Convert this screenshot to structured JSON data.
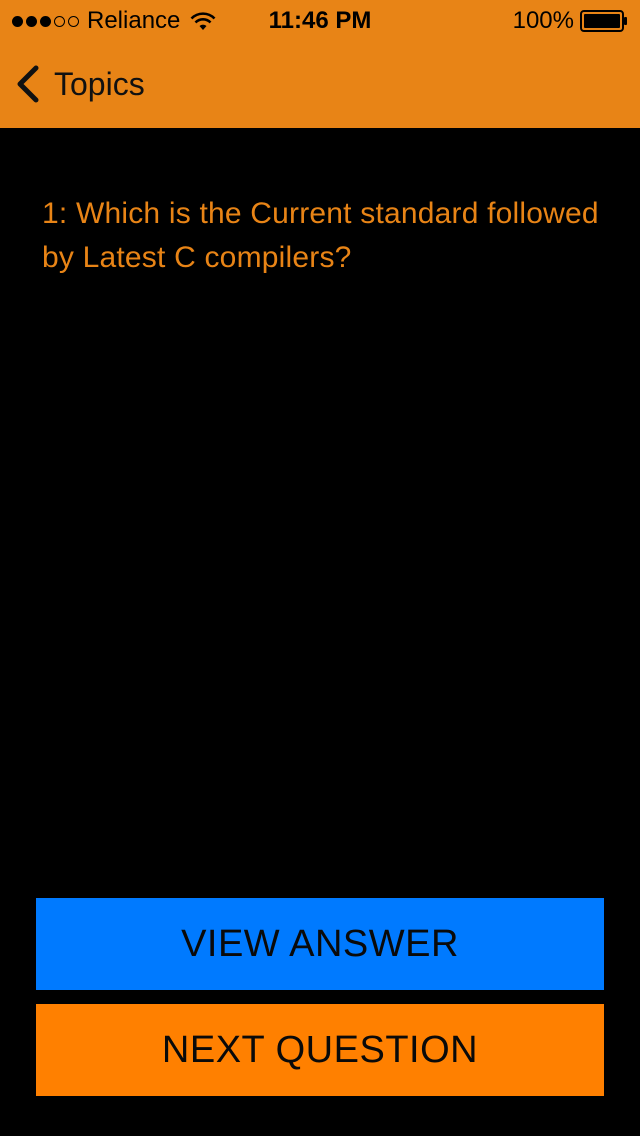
{
  "status_bar": {
    "carrier": "Reliance",
    "time": "11:46 PM",
    "battery": "100%",
    "signal_filled": 3,
    "signal_total": 5
  },
  "nav": {
    "back_label": "Topics",
    "back_icon": "chevron-left-icon"
  },
  "question": {
    "text": "1: Which is the Current standard followed by Latest C compilers?"
  },
  "buttons": {
    "view_answer": "VIEW ANSWER",
    "next_question": "NEXT QUESTION"
  },
  "colors": {
    "header": "#E88416",
    "question_text": "#E88416",
    "view_button": "#007AFF",
    "next_button": "#FF8000",
    "background": "#000000"
  }
}
